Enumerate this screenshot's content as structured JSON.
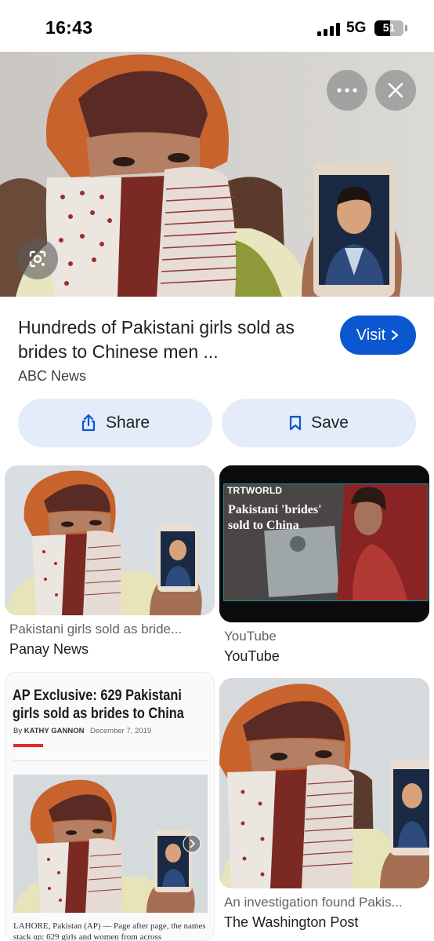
{
  "status_bar": {
    "time": "16:43",
    "network": "5G",
    "battery": "51"
  },
  "hero": {
    "more_icon": "more-horizontal-icon",
    "close_icon": "close-icon",
    "lens_icon": "google-lens-icon"
  },
  "result": {
    "title": "Hundreds of Pakistani girls sold as brides to Chinese men ...",
    "source": "ABC News",
    "visit_label": "Visit",
    "share_label": "Share",
    "save_label": "Save"
  },
  "related": [
    {
      "caption": "Pakistani girls sold as bride...",
      "source": "Panay News"
    },
    {
      "caption": "YouTube",
      "source": "YouTube",
      "channel_logo": "TRTWORLD",
      "overlay_title": "Pakistani 'brides' sold to China"
    },
    {
      "article": {
        "headline": "AP Exclusive: 629 Pakistani girls sold as brides to China",
        "byline_prefix": "By",
        "author": "KATHY GANNON",
        "date": "December 7, 2019",
        "body": "LAHORE, Pakistan (AP) — Page after page, the names stack up: 629 girls and women from across"
      }
    },
    {
      "caption": "An investigation found Pakis...",
      "source": "The Washington Post"
    }
  ],
  "colors": {
    "accent": "#0b57d0",
    "pill_bg": "#e4ecfa",
    "article_red": "#e02a2a"
  }
}
